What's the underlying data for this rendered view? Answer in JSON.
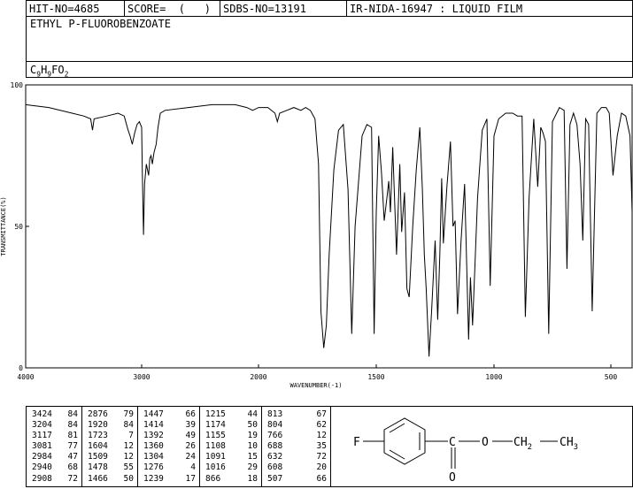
{
  "header": {
    "hit": "HIT-NO=4685",
    "score": "SCORE=  (   )",
    "sdbs": "SDBS-NO=13191",
    "irnida": "IR-NIDA-16947 : LIQUID FILM"
  },
  "compound_name": "ETHYL P-FLUOROBENZOATE",
  "formula": {
    "c": "C",
    "c_n": "9",
    "h": "H",
    "h_n": "9",
    "rest": "FO",
    "o_n": "2"
  },
  "chart_data": {
    "type": "line",
    "title": "",
    "xlabel": "WAVENUMBER(-1)",
    "ylabel": "TRANSMITTANCE(%)",
    "xlim": [
      4000,
      400
    ],
    "ylim": [
      0,
      100
    ],
    "x_ticks": [
      "4000",
      "3000",
      "2000",
      "1500",
      "1000",
      "500"
    ],
    "y_ticks": [
      "100",
      "50",
      "0"
    ],
    "series": [
      {
        "x": [
          4000,
          3800,
          3600,
          3500,
          3440,
          3424,
          3410,
          3300,
          3204,
          3150,
          3117,
          3100,
          3081,
          3060,
          3040,
          3020,
          3000,
          2995,
          2984,
          2975,
          2960,
          2940,
          2930,
          2920,
          2908,
          2895,
          2876,
          2860,
          2840,
          2800,
          2600,
          2400,
          2300,
          2200,
          2100,
          2050,
          2000,
          1960,
          1930,
          1920,
          1910,
          1880,
          1850,
          1820,
          1800,
          1780,
          1760,
          1745,
          1735,
          1723,
          1712,
          1700,
          1680,
          1660,
          1640,
          1620,
          1604,
          1590,
          1560,
          1540,
          1520,
          1509,
          1500,
          1490,
          1478,
          1466,
          1455,
          1447,
          1440,
          1430,
          1414,
          1400,
          1392,
          1380,
          1370,
          1360,
          1345,
          1330,
          1315,
          1304,
          1296,
          1288,
          1276,
          1265,
          1250,
          1239,
          1230,
          1222,
          1215,
          1200,
          1185,
          1174,
          1165,
          1155,
          1140,
          1125,
          1108,
          1100,
          1091,
          1080,
          1070,
          1050,
          1030,
          1016,
          1000,
          980,
          950,
          920,
          900,
          880,
          866,
          850,
          830,
          813,
          800,
          790,
          780,
          766,
          750,
          720,
          700,
          688,
          675,
          660,
          645,
          632,
          620,
          608,
          595,
          580,
          560,
          540,
          520,
          507,
          490,
          470,
          450,
          430,
          410,
          400
        ],
        "y": [
          93,
          92,
          90,
          89,
          88,
          84,
          88,
          89,
          90,
          89,
          84,
          82,
          79,
          83,
          86,
          87,
          85,
          70,
          47,
          65,
          72,
          68,
          74,
          75,
          72,
          76,
          79,
          85,
          90,
          91,
          92,
          93,
          93,
          93,
          92,
          91,
          92,
          92,
          90,
          87,
          90,
          91,
          92,
          91,
          92,
          91,
          88,
          72,
          20,
          7,
          15,
          40,
          70,
          84,
          86,
          63,
          12,
          50,
          82,
          86,
          85,
          12,
          55,
          82,
          69,
          52,
          60,
          66,
          55,
          78,
          40,
          72,
          48,
          62,
          28,
          25,
          50,
          70,
          85,
          63,
          40,
          28,
          4,
          20,
          45,
          17,
          40,
          67,
          44,
          64,
          80,
          50,
          52,
          19,
          45,
          65,
          10,
          32,
          15,
          38,
          60,
          84,
          88,
          29,
          82,
          88,
          90,
          90,
          89,
          89,
          18,
          60,
          88,
          64,
          85,
          83,
          80,
          12,
          87,
          92,
          91,
          35,
          86,
          90,
          86,
          72,
          45,
          88,
          86,
          20,
          90,
          92,
          92,
          90,
          68,
          82,
          90,
          89,
          82,
          55
        ]
      }
    ]
  },
  "peak_table": [
    [
      [
        "3424",
        "84"
      ],
      [
        "3204",
        "84"
      ],
      [
        "3117",
        "81"
      ],
      [
        "3081",
        "77"
      ],
      [
        "2984",
        "47"
      ],
      [
        "2940",
        "68"
      ],
      [
        "2908",
        "72"
      ]
    ],
    [
      [
        "2876",
        "79"
      ],
      [
        "1920",
        "84"
      ],
      [
        "1723",
        "7"
      ],
      [
        "1604",
        "12"
      ],
      [
        "1509",
        "12"
      ],
      [
        "1478",
        "55"
      ],
      [
        "1466",
        "50"
      ]
    ],
    [
      [
        "1447",
        "66"
      ],
      [
        "1414",
        "39"
      ],
      [
        "1392",
        "49"
      ],
      [
        "1360",
        "26"
      ],
      [
        "1304",
        "24"
      ],
      [
        "1276",
        "4"
      ],
      [
        "1239",
        "17"
      ]
    ],
    [
      [
        "1215",
        "44"
      ],
      [
        "1174",
        "50"
      ],
      [
        "1155",
        "19"
      ],
      [
        "1108",
        "10"
      ],
      [
        "1091",
        "15"
      ],
      [
        "1016",
        "29"
      ],
      [
        "866",
        "18"
      ]
    ],
    [
      [
        "813",
        "67"
      ],
      [
        "804",
        "62"
      ],
      [
        "766",
        "12"
      ],
      [
        "688",
        "35"
      ],
      [
        "632",
        "72"
      ],
      [
        "608",
        "20"
      ],
      [
        "507",
        "66"
      ]
    ]
  ],
  "structure": {
    "f": "F",
    "c": "C",
    "o_ester": "O",
    "o_carbonyl": "O",
    "ch2": "CH",
    "ch2_n": "2",
    "ch3": "CH",
    "ch3_n": "3"
  }
}
